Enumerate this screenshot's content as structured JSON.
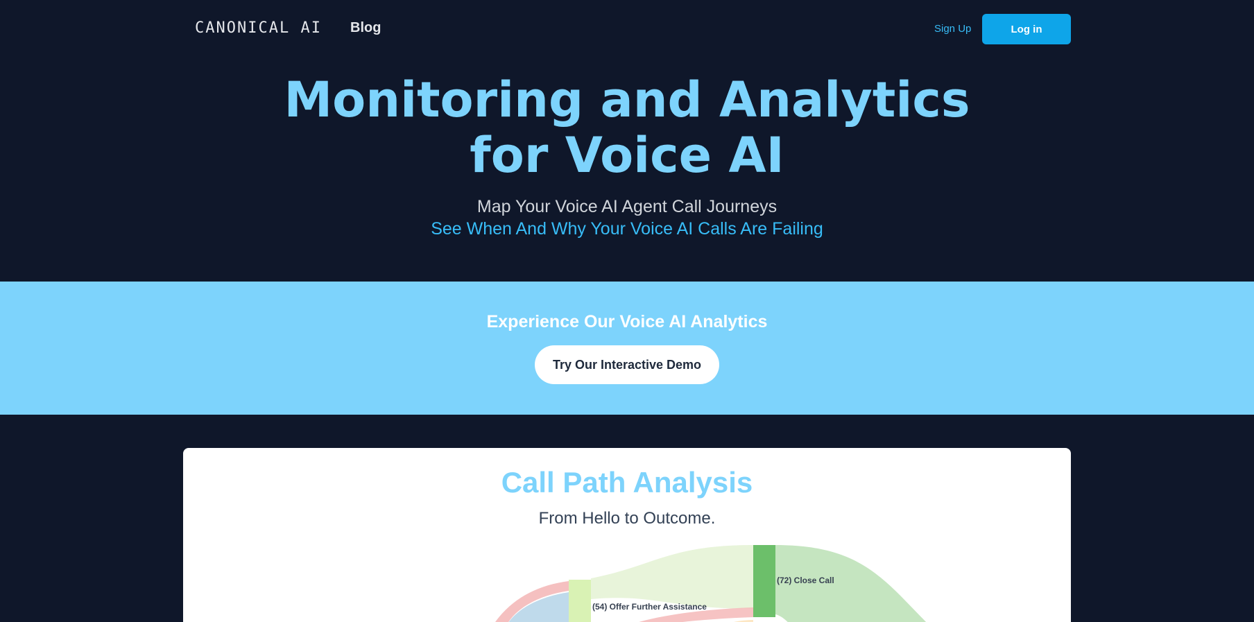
{
  "header": {
    "logo": "CANONICAL AI",
    "nav_blog": "Blog",
    "sign_up": "Sign Up",
    "log_in": "Log in"
  },
  "hero": {
    "title_line1": "Monitoring and Analytics",
    "title_line2": "for Voice AI",
    "subtitle": "Map Your Voice AI Agent Call Journeys",
    "tagline": "See When And Why Your Voice AI Calls Are Failing"
  },
  "cta": {
    "heading": "Experience Our Voice AI Analytics",
    "button": "Try Our Interactive Demo"
  },
  "call_path": {
    "title": "Call Path Analysis",
    "subtitle": "From Hello to Outcome.",
    "nodes": [
      {
        "label": "(54) Offer Further Assistance",
        "color": "#d9f2b4"
      },
      {
        "label": "(72) Close Call",
        "color": "#6cbf6a"
      }
    ]
  },
  "colors": {
    "background": "#0f172a",
    "accent": "#7dd3fc",
    "button": "#0ea5e9"
  }
}
